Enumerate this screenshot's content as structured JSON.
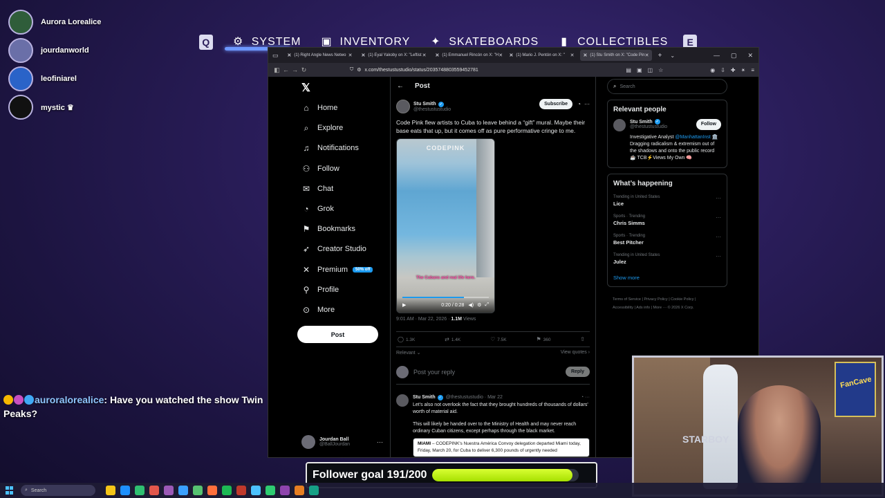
{
  "viewers": [
    {
      "name": "Aurora Lorealice",
      "color": "#2f5d3a"
    },
    {
      "name": "jourdanworld",
      "color": "#6a6fa8"
    },
    {
      "name": "leofiniarel",
      "color": "#2a63c8"
    },
    {
      "name": "mystic ♛",
      "color": "#111111"
    }
  ],
  "game_menu": {
    "left_key": "Q",
    "right_key": "E",
    "items": [
      {
        "label": "SYSTEM",
        "icon": "gear-icon",
        "glyph": "⚙"
      },
      {
        "label": "INVENTORY",
        "icon": "backpack-icon",
        "glyph": "▣"
      },
      {
        "label": "SKATEBOARDS",
        "icon": "skateboard-icon",
        "glyph": "✦"
      },
      {
        "label": "COLLECTIBLES",
        "icon": "card-icon",
        "glyph": "▮"
      }
    ]
  },
  "browser": {
    "tabs": [
      {
        "label": "(1) Right Angle News Netwo"
      },
      {
        "label": "(1) Eyal Yakoby on X: \"Leftist"
      },
      {
        "label": "(1) Emmanuel Rincón on X: \"H"
      },
      {
        "label": "(1) Mario J. Pentón on X: \""
      },
      {
        "label": "(1) Stu Smith on X: \"Code Pin"
      }
    ],
    "url": "x.com/thestustustudio/status/2035748803559452781"
  },
  "nav": {
    "items": [
      {
        "label": "Home",
        "icon": "home-icon",
        "glyph": "⌂"
      },
      {
        "label": "Explore",
        "icon": "search-icon",
        "glyph": "⌕"
      },
      {
        "label": "Notifications",
        "icon": "bell-icon",
        "glyph": "♫"
      },
      {
        "label": "Follow",
        "icon": "add-person-icon",
        "glyph": "⚇"
      },
      {
        "label": "Chat",
        "icon": "mail-icon",
        "glyph": "✉"
      },
      {
        "label": "Grok",
        "icon": "grok-icon",
        "glyph": "◔"
      },
      {
        "label": "Bookmarks",
        "icon": "bookmark-icon",
        "glyph": "⚑"
      },
      {
        "label": "Creator Studio",
        "icon": "rocket-icon",
        "glyph": "➶"
      },
      {
        "label": "Premium",
        "icon": "x-logo-icon",
        "glyph": "✕"
      },
      {
        "label": "Profile",
        "icon": "person-icon",
        "glyph": "⚲"
      },
      {
        "label": "More",
        "icon": "more-circle-icon",
        "glyph": "⊙"
      }
    ],
    "premium_badge": "50% off",
    "post_button": "Post",
    "account": {
      "name": "Jourdan Ball",
      "handle": "@BallJourdan"
    }
  },
  "post": {
    "header": "Post",
    "author": {
      "name": "Stu Smith",
      "handle": "@thestustustudio"
    },
    "subscribe": "Subscribe",
    "text": "Code Pink flew artists to Cuba to leave behind a “gift” mural. Maybe their base eats that up, but it comes off as pure performative cringe to me.",
    "video": {
      "watermark": "CODEPINK",
      "caption": "The Cubans and real life here.",
      "time": "0:20 / 0:28",
      "progress": 0.71
    },
    "timestamp": "9:01 AM · Mar 22, 2026 · ",
    "views_count": "1.1M",
    "views_label": "Views",
    "replies": "1.3K",
    "reposts": "1.4K",
    "likes": "7.5K",
    "bookmarks": "360",
    "relevant": "Relevant",
    "view_quotes": "View quotes",
    "reply_placeholder": "Post your reply",
    "reply_button": "Reply"
  },
  "reply_tweet": {
    "name": "Stu Smith",
    "handle": "@thestustustudio · Mar 22",
    "text1": "Let's also not overlook the fact that they brought hundreds of thousands of dollars' worth of material aid.",
    "text2": "This will likely be handed over to the Ministry of Health and may never reach ordinary Cuban citizens, except perhaps through the black market.",
    "quote_place": "MIAMI",
    "quote_text": " – CODEPINK's Nuestra América Convoy delegation departed Miami today, Friday, March 20, for Cuba to deliver 6,300 pounds of urgently needed"
  },
  "right": {
    "search_placeholder": "Search",
    "relevant_title": "Relevant people",
    "person": {
      "name": "Stu Smith",
      "handle": "@thestustustudio",
      "follow": "Follow",
      "bio_pre": "Investigative Analyst ",
      "bio_mention": "@ManhattanInst",
      "bio_post": " 🏛️ Dragging radicalism & extremism out of the shadows and onto the public record ☕ TCB⚡Views My Own 🧠"
    },
    "happening_title": "What’s happening",
    "trends": [
      {
        "context": "Trending in United States",
        "name": "Lice"
      },
      {
        "context": "Sports · Trending",
        "name": "Chris Simms"
      },
      {
        "context": "Sports · Trending",
        "name": "Best Pitcher"
      },
      {
        "context": "Trending in United States",
        "name": "Julez"
      }
    ],
    "show_more": "Show more",
    "footer1": "Terms of Service  |  Privacy Policy  |  Cookie Policy  |",
    "footer2": "Accessibility  |  Ads info  |  More ···  © 2026 X Corp."
  },
  "chat": {
    "username": "auroralorealice",
    "message": "Have you watched the show Twin Peaks?"
  },
  "webcam": {
    "starboy_text": "STARBOY",
    "fan_text": "FanCave"
  },
  "follower_goal": {
    "label": "Follower goal 191/200",
    "progress": 0.955
  },
  "taskbar": {
    "search_label": "Search",
    "apps": [
      "#f5c518",
      "#1e90ff",
      "#2fbf71",
      "#e2574c",
      "#9b59b6",
      "#3aa0ff",
      "#56c271",
      "#ff6f3c",
      "#1db954",
      "#c0392b",
      "#4cc2ff",
      "#2ecc71",
      "#8e44ad",
      "#e67e22",
      "#16a085"
    ]
  }
}
